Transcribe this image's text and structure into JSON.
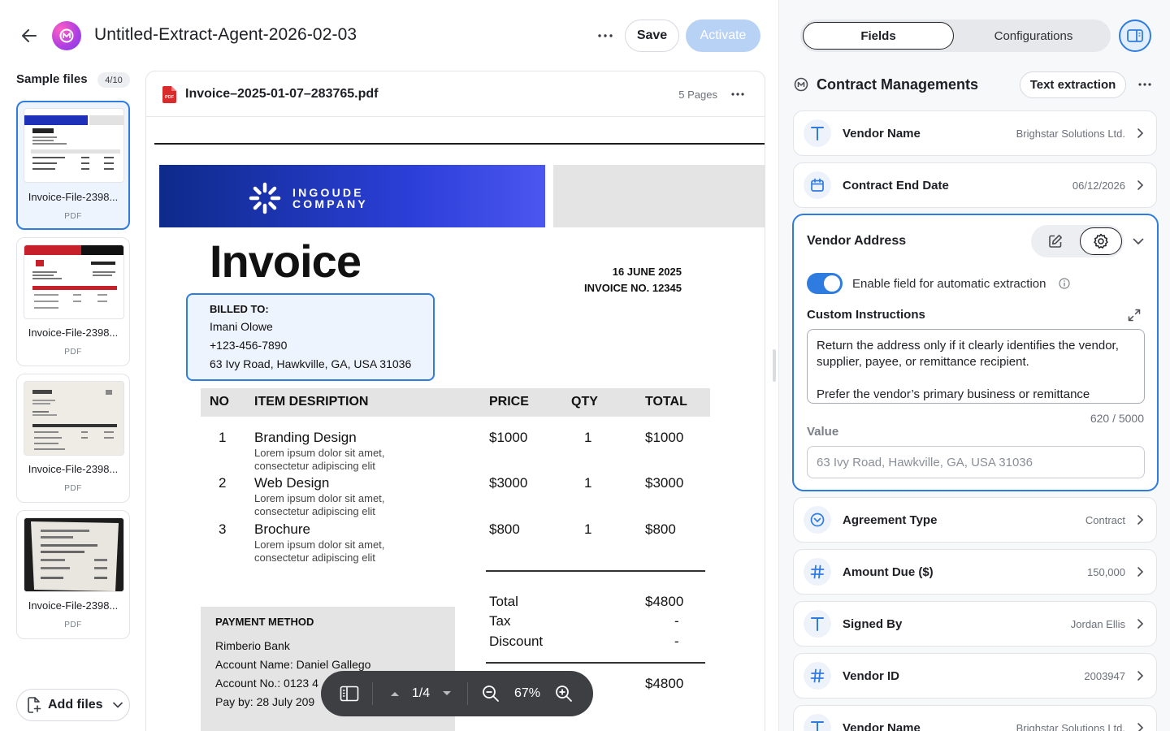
{
  "header": {
    "title": "Untitled-Extract-Agent-2026-02-03",
    "save_label": "Save",
    "activate_label": "Activate"
  },
  "sidebar": {
    "label": "Sample files",
    "count": "4/10",
    "files": [
      {
        "name": "Invoice-File-2398...",
        "type": "PDF"
      },
      {
        "name": "Invoice-File-2398...",
        "type": "PDF"
      },
      {
        "name": "Invoice-File-2398...",
        "type": "PDF"
      },
      {
        "name": "Invoice-File-2398...",
        "type": "PDF"
      }
    ],
    "add_files_label": "Add files"
  },
  "viewer": {
    "file_name": "Invoice–2025-01-07–283765.pdf",
    "pages_label": "5 Pages",
    "page_indicator": "1/4",
    "zoom": "67%"
  },
  "invoice": {
    "company_line1": "INGOUDE",
    "company_line2": "COMPANY",
    "title": "Invoice",
    "date": "16 JUNE 2025",
    "number": "INVOICE NO. 12345",
    "billed_label": "BILLED TO:",
    "billed_name": "Imani Olowe",
    "billed_phone": "+123-456-7890",
    "billed_address": "63 Ivy Road, Hawkville, GA, USA 31036",
    "columns": [
      "NO",
      "ITEM DESRIPTION",
      "PRICE",
      "QTY",
      "TOTAL"
    ],
    "rows": [
      {
        "no": "1",
        "item": "Branding Design",
        "desc1": "Lorem ipsum dolor sit amet,",
        "desc2": "consectetur adipiscing elit",
        "price": "$1000",
        "qty": "1",
        "total": "$1000"
      },
      {
        "no": "2",
        "item": "Web Design",
        "desc1": "Lorem ipsum dolor sit amet,",
        "desc2": "consectetur adipiscing elit",
        "price": "$3000",
        "qty": "1",
        "total": "$3000"
      },
      {
        "no": "3",
        "item": "Brochure",
        "desc1": "Lorem ipsum dolor sit amet,",
        "desc2": "consectetur adipiscing elit",
        "price": "$800",
        "qty": "1",
        "total": "$800"
      }
    ],
    "payment_label": "PAYMENT METHOD",
    "payment_bank": "Rimberio Bank",
    "payment_account_name": "Account Name: Daniel Gallego",
    "payment_account_no": "Account No.: 0123 4",
    "payment_pay_by": "Pay by: 28 July 209",
    "total_label": "Total",
    "total_value": "$4800",
    "tax_label": "Tax",
    "tax_value": "-",
    "discount_label": "Discount",
    "discount_value": "-",
    "grand_total": "$4800"
  },
  "panel": {
    "tab_fields": "Fields",
    "tab_configurations": "Configurations",
    "section_title": "Contract Managements",
    "text_extraction_label": "Text extraction",
    "fields_top": [
      {
        "name": "Vendor Name",
        "value": "Brighstar Solutions Ltd.",
        "icon": "text-icon"
      },
      {
        "name": "Contract End Date",
        "value": "06/12/2026",
        "icon": "calendar-icon"
      }
    ],
    "vendor_address": {
      "title": "Vendor Address",
      "toggle_label": "Enable field for automatic extraction",
      "custom_instructions_label": "Custom Instructions",
      "custom_instructions": "Return the address only if it clearly identifies the vendor, supplier, payee, or remittance recipient.\n\nPrefer the vendor’s primary business or remittance",
      "char_count": "620 / 5000",
      "value_label": "Value",
      "value_placeholder": "63 Ivy Road, Hawkville, GA, USA 31036"
    },
    "fields_bottom": [
      {
        "name": "Agreement Type",
        "value": "Contract",
        "icon": "chevron-circle-icon"
      },
      {
        "name": "Amount Due ($)",
        "value": "150,000",
        "icon": "hash-icon"
      },
      {
        "name": "Signed By",
        "value": "Jordan Ellis",
        "icon": "text-icon"
      },
      {
        "name": "Vendor ID",
        "value": "2003947",
        "icon": "hash-icon"
      },
      {
        "name": "Vendor Name",
        "value": "Brighstar Solutions Ltd.",
        "icon": "text-icon"
      }
    ]
  },
  "colors": {
    "accent": "#2f7ce0",
    "activate_disabled": "#b8d2f5",
    "banner_blue": "#1f36c7"
  }
}
